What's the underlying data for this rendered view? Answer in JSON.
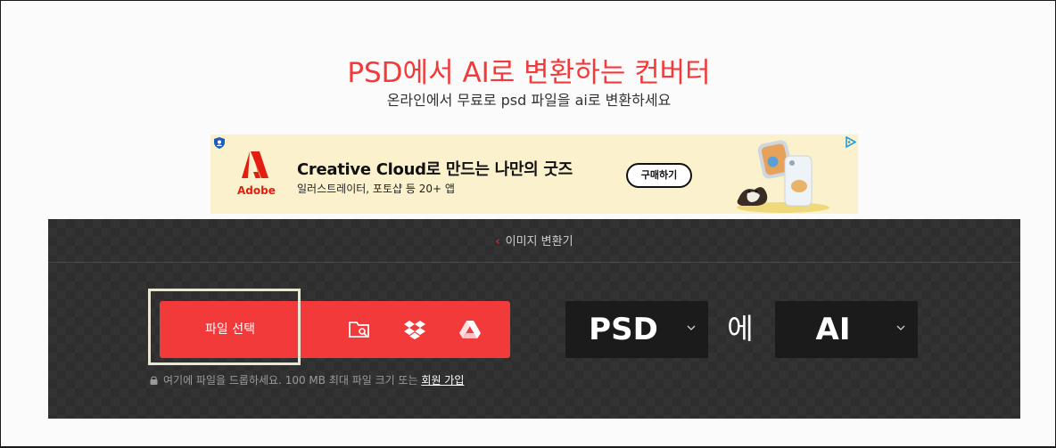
{
  "header": {
    "title": "PSD에서 AI로 변환하는 컨버터",
    "subtitle": "온라인에서 무료로 psd 파일을 ai로 변환하세요"
  },
  "ad": {
    "brand": "Adobe",
    "headline": "Creative Cloud로 만드는 나만의 굿즈",
    "subline": "일러스트레이터, 포토샵 등 20+ 앱",
    "cta_label": "구매하기",
    "background": "#fbf1cc"
  },
  "converter": {
    "breadcrumb": "이미지 변환기",
    "upload_label": "파일 선택",
    "icons": [
      "folder-search-icon",
      "dropbox-icon",
      "google-drive-icon"
    ],
    "note_text": "여기에 파일을 드롭하세요. 100 MB 최대 파일 크기 또는 ",
    "note_link": "회원 가입",
    "from_format": "PSD",
    "connector": "에",
    "to_format": "AI"
  },
  "colors": {
    "accent": "#f23a3a",
    "panel_bg": "#2e2e2e",
    "select_bg": "#1b1b1b"
  }
}
